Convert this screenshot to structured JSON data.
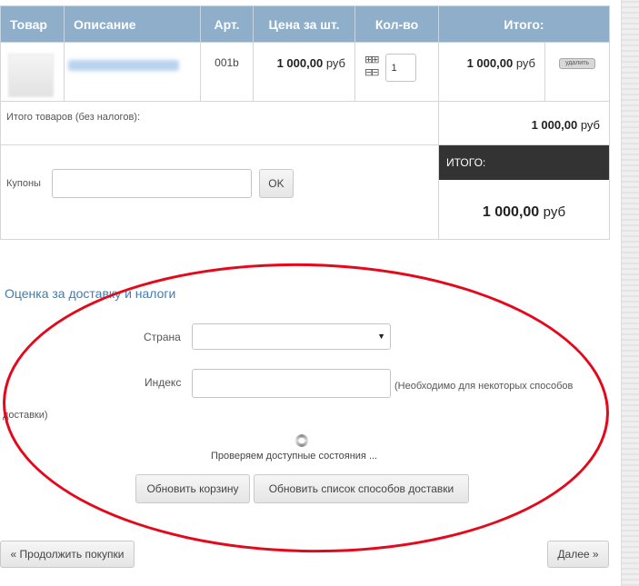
{
  "table": {
    "headers": {
      "product": "Товар",
      "description": "Описание",
      "sku": "Арт.",
      "unit_price": "Цена за шт.",
      "quantity": "Кол-во",
      "total": "Итого:"
    },
    "row": {
      "sku": "001b",
      "unit_price": "1 000,00",
      "unit_price_currency": "руб",
      "quantity": "1",
      "total": "1 000,00",
      "total_currency": "руб",
      "delete_label": "удалить"
    }
  },
  "summary": {
    "subtotal_label": "Итого товаров (без налогов):",
    "subtotal_value": "1 000,00",
    "subtotal_currency": "руб",
    "coupon_label": "Купоны",
    "coupon_button": "OK",
    "grand_total_label": "ИТОГО:",
    "grand_total_value": "1 000,00",
    "grand_total_currency": "руб"
  },
  "shipping": {
    "title": "Оценка за доставку и налоги",
    "country_label": "Страна",
    "zip_label": "Индекс",
    "zip_hint_part1": "(Необходимо для некоторых способов",
    "zip_hint_part2": "доставки)",
    "status": "Проверяем доступные состояния ...",
    "update_cart_button": "Обновить корзину",
    "update_shipping_button": "Обновить список способов доставки"
  },
  "nav": {
    "continue_button": "« Продолжить покупки",
    "next_button": "Далее »"
  },
  "colors": {
    "header_bg": "#8eaec9",
    "total_header_bg": "#333333",
    "link": "#3f7cb2",
    "annotation_ellipse": "#e5081a"
  }
}
